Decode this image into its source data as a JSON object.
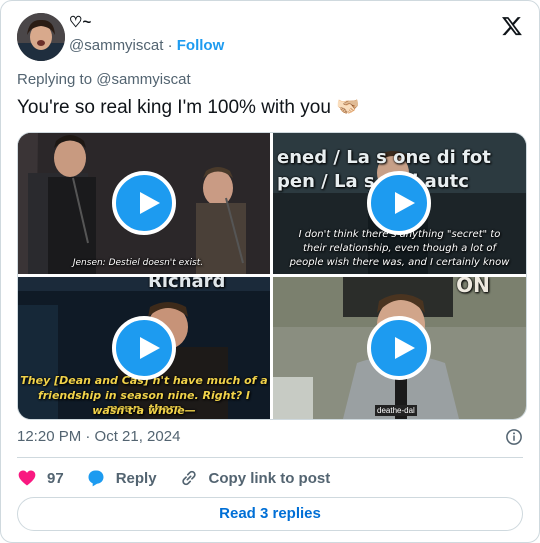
{
  "author": {
    "display_name": "♡~",
    "handle": "@sammyiscat",
    "separator": " · ",
    "follow_label": "Follow"
  },
  "reply_to": "Replying to @sammyiscat",
  "tweet_text": "You're so real king I'm 100% with you 🫱🏻‍🫲🏼",
  "media": {
    "tile1_caption": "Jensen: Destiel doesn't exist.",
    "tile2_header_1": "ened / La s    one di fot",
    "tile2_header_2": "pen / La s       e di autc",
    "tile2_caption_1": "I don't think there's anything \"secret\" to",
    "tile2_caption_2": "their relationship, even though a lot of",
    "tile2_caption_3": "people wish there was, and I certainly know",
    "tile3_header": "Richard",
    "tile3_caption_1": "They [Dean and Cas]      n't have much of a",
    "tile3_caption_2": "friendship in season nine. Right? I mean, there",
    "tile3_caption_3": "wasn't a whole—",
    "tile4_tag": "deathe-dal",
    "tile4_sign": "ON"
  },
  "timestamp": "12:20 PM · Oct 21, 2024",
  "actions": {
    "like_count": "97",
    "reply_label": "Reply",
    "copy_label": "Copy link to post"
  },
  "read_replies_label": "Read 3 replies",
  "colors": {
    "accent": "#1d9bf0",
    "like": "#f91880",
    "muted": "#536471",
    "link": "#006fd6"
  }
}
